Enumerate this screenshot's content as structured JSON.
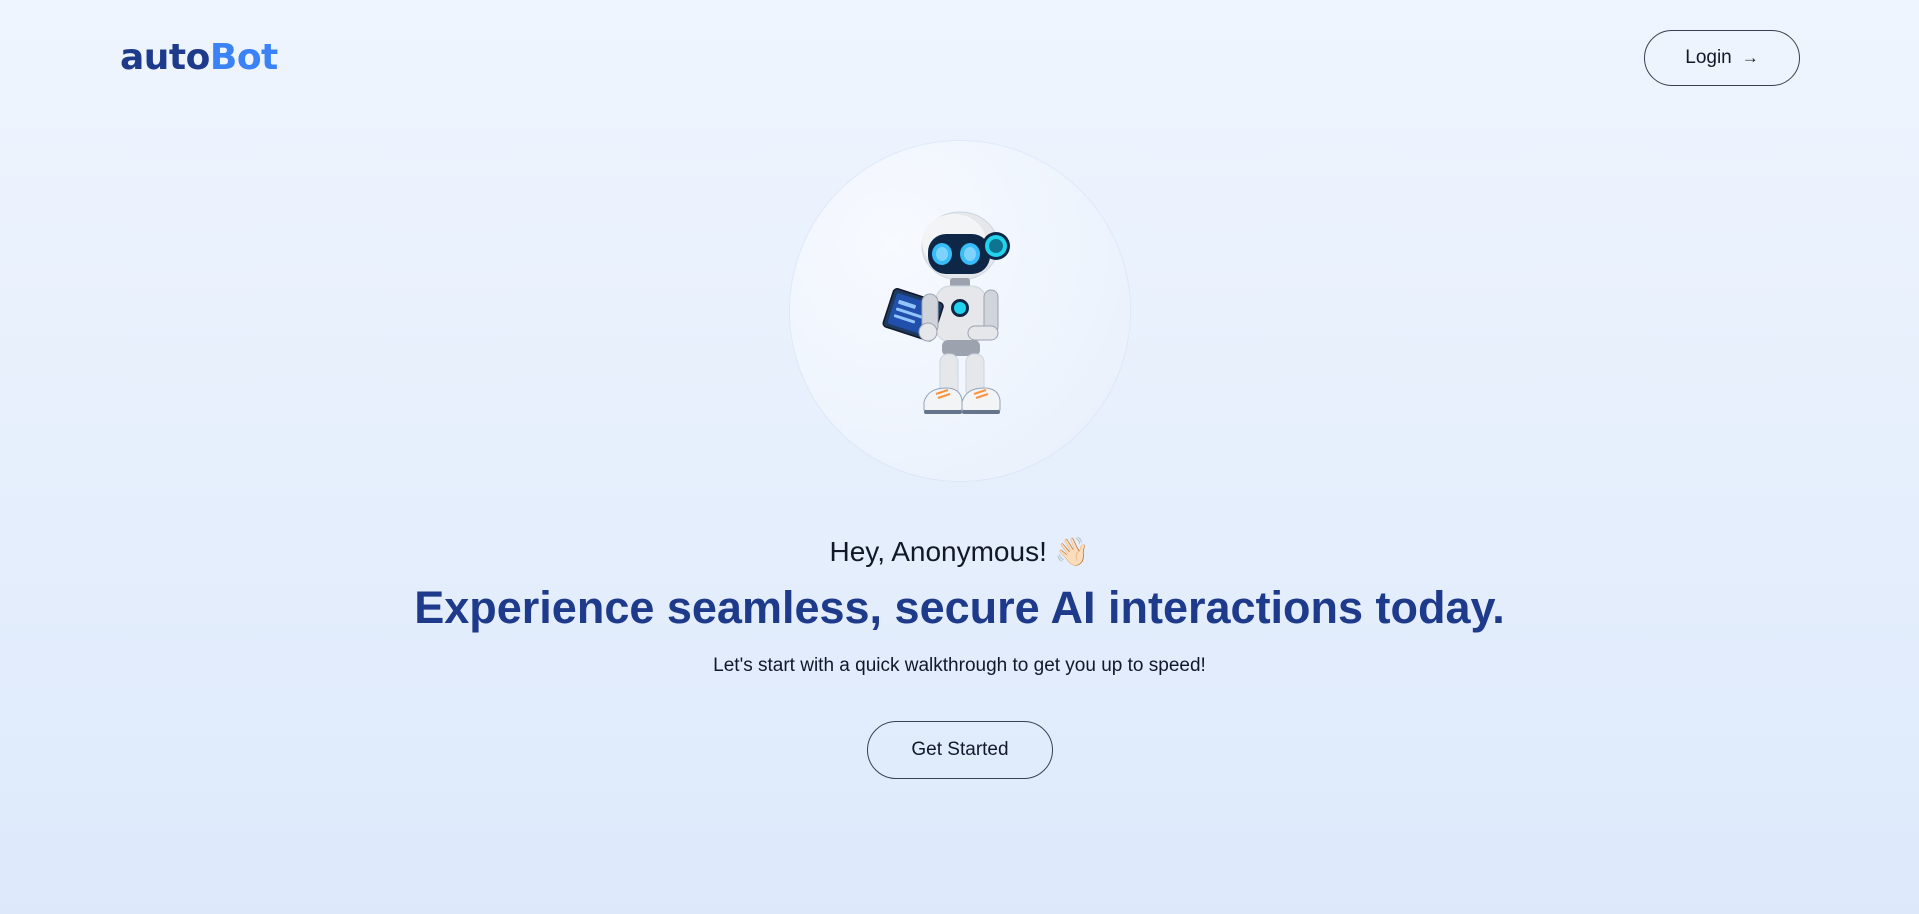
{
  "header": {
    "logo_part1": "auto",
    "logo_part2": "Bot",
    "login_label": "Login",
    "login_icon": "arrow-right-icon"
  },
  "hero": {
    "illustration": "robot-holding-tablet",
    "greeting": "Hey, Anonymous!",
    "greeting_emoji": "👋🏻",
    "headline": "Experience seamless, secure AI interactions today.",
    "subtext": "Let's start with a quick walkthrough to get you up to speed!",
    "cta_label": "Get Started"
  },
  "colors": {
    "brand_dark": "#1e3a8a",
    "brand_accent": "#3b82f6",
    "background_top": "#eff5fe",
    "background_bottom": "#dde9fb",
    "text": "#111827"
  }
}
